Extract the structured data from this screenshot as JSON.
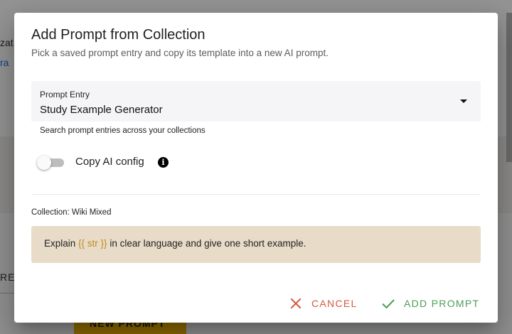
{
  "background": {
    "fragment_1": "zat",
    "fragment_2": "ra",
    "fragment_3": "RE(",
    "button_label": "NEW PROMPT"
  },
  "dialog": {
    "title": "Add Prompt from Collection",
    "subtitle": "Pick a saved prompt entry and copy its template into a new AI prompt.",
    "prompt_entry": {
      "label": "Prompt Entry",
      "value": "Study Example Generator",
      "helper": "Search prompt entries across your collections"
    },
    "copy_config": {
      "label": "Copy AI config",
      "checked": false,
      "info_glyph": "i"
    },
    "collection_text": "Collection: Wiki Mixed",
    "template": {
      "before": "Explain ",
      "variable": "{{ str }}",
      "after": " in clear language and give one short example."
    },
    "actions": {
      "cancel_label": "CANCEL",
      "add_label": "ADD PROMPT"
    }
  },
  "colors": {
    "cancel": "#d35a3f",
    "add": "#4a9f55",
    "variable": "#c08a1b",
    "preview_bg": "#e8dcc8"
  },
  "icons": {
    "dropdown": "chevron-down-icon",
    "info": "info-icon",
    "cancel": "close-icon",
    "add": "check-icon"
  }
}
